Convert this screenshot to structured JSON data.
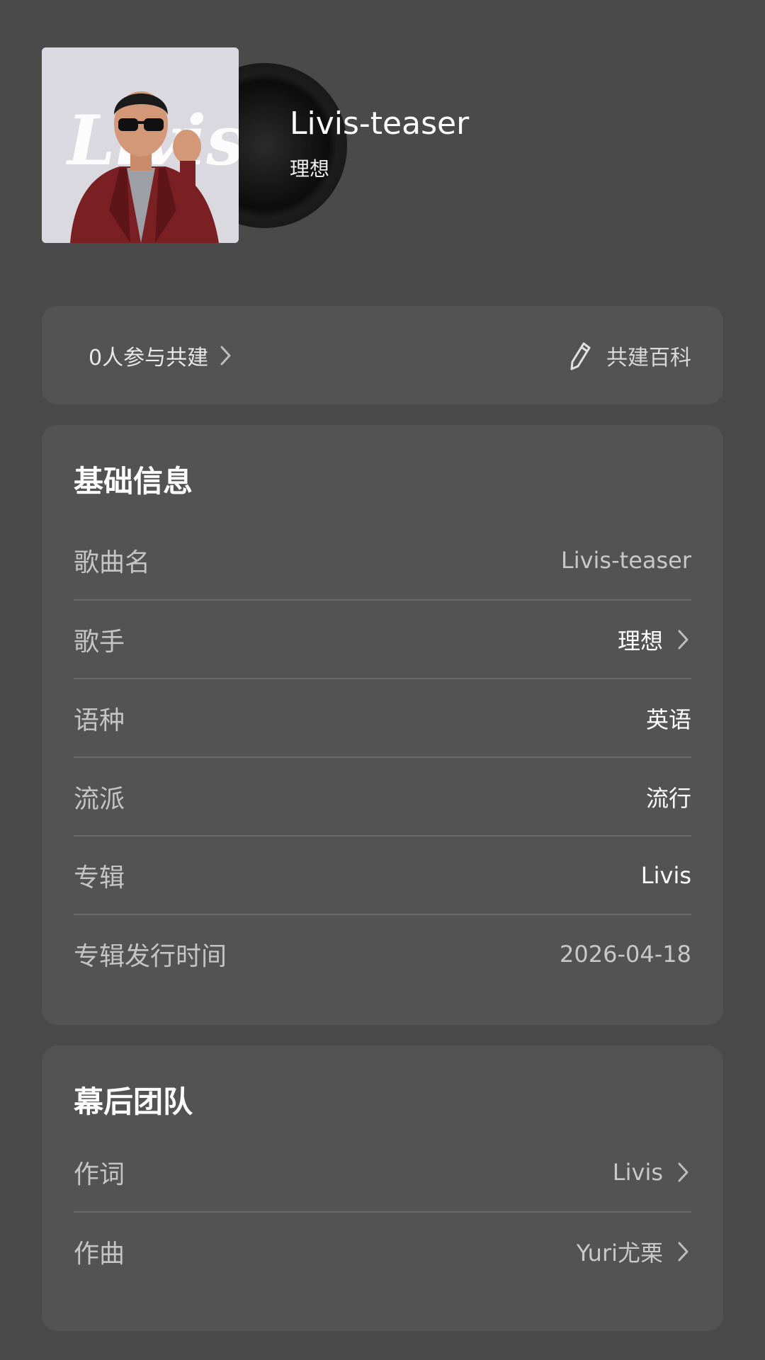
{
  "header": {
    "song_title": "Livis-teaser",
    "artist": "理想",
    "cover_text": "Livis"
  },
  "collab": {
    "participants_label": "0人参与共建",
    "edit_label": "共建百科",
    "participants_chevron_icon": "chevron-right-icon",
    "edit_icon": "pencil-icon"
  },
  "basic_info": {
    "title": "基础信息",
    "rows": [
      {
        "label": "歌曲名",
        "value": "Livis-teaser",
        "link": false
      },
      {
        "label": "歌手",
        "value": "理想",
        "link": true
      },
      {
        "label": "语种",
        "value": "英语",
        "link": false
      },
      {
        "label": "流派",
        "value": "流行",
        "link": false
      },
      {
        "label": "专辑",
        "value": "Livis",
        "link": false
      },
      {
        "label": "专辑发行时间",
        "value": "2026-04-18",
        "link": false
      }
    ]
  },
  "team": {
    "title": "幕后团队",
    "rows": [
      {
        "label": "作词",
        "value": "Livis",
        "link": true
      },
      {
        "label": "作曲",
        "value": "Yuri尤栗",
        "link": true
      }
    ]
  },
  "colors": {
    "background": "#4a4a4a",
    "card": "#535353",
    "divider": "#6a6a6a",
    "label": "#c4c4c4",
    "value": "#ffffff"
  }
}
